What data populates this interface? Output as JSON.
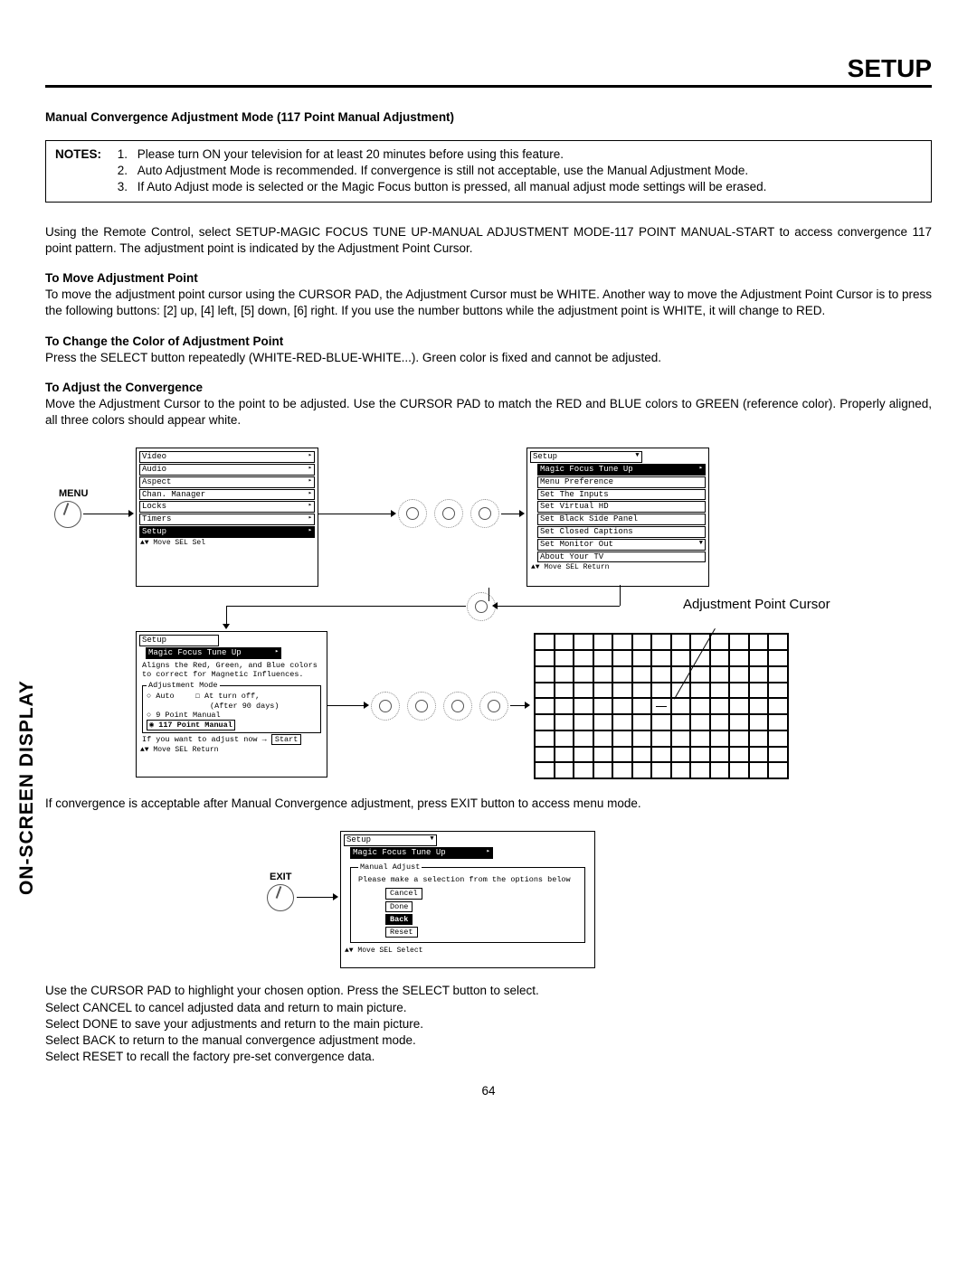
{
  "header": "SETUP",
  "side_label": "ON-SCREEN DISPLAY",
  "subtitle": "Manual Convergence Adjustment Mode (117 Point Manual Adjustment)",
  "notes_label": "NOTES:",
  "notes": [
    "Please turn ON your television for at least 20 minutes before using this feature.",
    "Auto Adjustment Mode is recommended.  If convergence is still not acceptable, use the Manual Adjustment Mode.",
    "If Auto Adjust mode is selected or the Magic Focus button is pressed, all manual adjust mode settings will be erased."
  ],
  "intro": "Using the Remote Control, select SETUP-MAGIC FOCUS TUNE UP-MANUAL ADJUSTMENT MODE-117 POINT MANUAL-START to access convergence 117 point pattern.  The adjustment point is indicated by the Adjustment Point Cursor.",
  "sections": {
    "move_head": "To Move Adjustment Point",
    "move_body": "To move the adjustment point cursor using the CURSOR PAD, the Adjustment Cursor must be WHITE.  Another way to move the Adjustment Point Cursor is to press the following buttons:  [2] up, [4] left, [5] down, [6] right.  If you use the number buttons while the adjustment point is WHITE, it will change to RED.",
    "color_head": "To Change the Color of Adjustment Point",
    "color_body": "Press the SELECT button repeatedly (WHITE-RED-BLUE-WHITE...).  Green color is fixed and cannot be adjusted.",
    "adjust_head": "To Adjust the Convergence",
    "adjust_body": "Move the Adjustment Cursor to the point to be adjusted.  Use the CURSOR PAD to match the RED and BLUE colors to GREEN (reference color).  Properly aligned, all three colors should appear white."
  },
  "labels": {
    "menu": "MENU",
    "exit": "EXIT",
    "cursor": "Adjustment Point Cursor"
  },
  "menu1": {
    "items": [
      "Video",
      "Audio",
      "Aspect",
      "Chan. Manager",
      "Locks",
      "Timers",
      "Setup"
    ],
    "selected": "Setup",
    "footer": "Move SEL Sel",
    "footer_sym": "▲▼"
  },
  "menu2": {
    "title": "Setup",
    "items": [
      "Magic Focus Tune Up",
      "Menu Preference",
      "Set The Inputs",
      "Set Virtual HD",
      "Set Black Side Panel",
      "Set Closed Captions",
      "Set Monitor Out",
      "About Your TV"
    ],
    "selected": "Magic Focus Tune Up",
    "footer": "Move SEL Return",
    "footer_sym": "▲▼"
  },
  "menu3": {
    "title": "Setup",
    "sub": "Magic Focus Tune Up",
    "desc": "Aligns the Red, Green, and Blue colors to correct for Magnetic Influences.",
    "group": "Adjustment Mode",
    "opt_auto": "Auto",
    "opt_auto_note1": "At turn off,",
    "opt_auto_note2": "(After 90 days)",
    "opt_9": "9 Point Manual",
    "opt_117": "117 Point Manual",
    "prompt": "If you want to adjust now",
    "start": "Start",
    "footer": "Move SEL Return",
    "footer_sym": "▲▼",
    "radio_empty": "○",
    "radio_full": "◉",
    "checkbox": "☐"
  },
  "after_fig": "If convergence is acceptable after Manual Convergence adjustment, press EXIT button to access menu mode.",
  "menu4": {
    "title": "Setup",
    "sub": "Magic Focus Tune Up",
    "group": "Manual Adjust",
    "prompt": "Please make a selection from the options below",
    "options": [
      "Cancel",
      "Done",
      "Back",
      "Reset"
    ],
    "selected": "Back",
    "footer": "Move SEL Select",
    "footer_sym": "▲▼"
  },
  "closing": [
    "Use the CURSOR PAD to highlight your chosen option.  Press the SELECT button to select.",
    "Select CANCEL to cancel adjusted data and return to main picture.",
    "Select DONE to save your adjustments and return to the main picture.",
    "Select BACK to return to the manual convergence adjustment mode.",
    "Select RESET to recall the factory pre-set convergence data."
  ],
  "page_number": "64",
  "arrow_sym": "→",
  "tri_right": "▸",
  "tri_down": "▼"
}
